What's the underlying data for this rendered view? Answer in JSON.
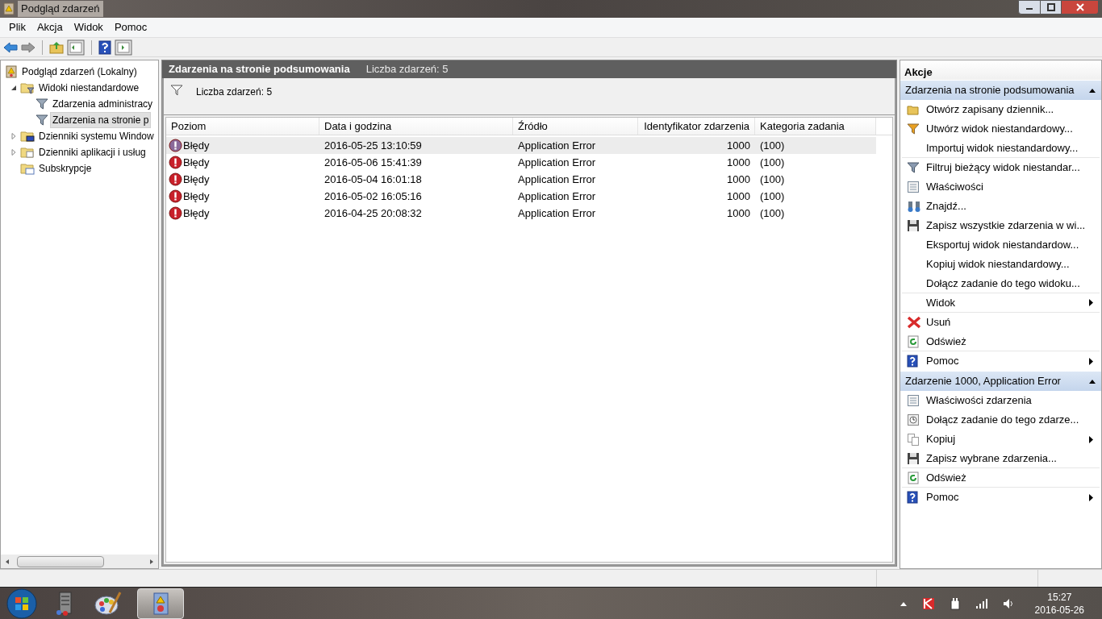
{
  "window": {
    "title": "Podgląd zdarzeń"
  },
  "menu": [
    "Plik",
    "Akcja",
    "Widok",
    "Pomoc"
  ],
  "tree": [
    {
      "label": "Podgląd zdarzeń (Lokalny)",
      "kind": "log",
      "selected": false,
      "children": [
        {
          "label": "Widoki niestandardowe",
          "kind": "folder-filter",
          "expanded": true,
          "selected": false,
          "children": [
            {
              "label": "Zdarzenia administracy",
              "kind": "filter",
              "selected": false
            },
            {
              "label": "Zdarzenia na stronie p",
              "kind": "filter",
              "selected": true
            }
          ]
        },
        {
          "label": "Dzienniki systemu Window",
          "kind": "folder-pc",
          "expanded": false,
          "selected": false
        },
        {
          "label": "Dzienniki aplikacji i usług",
          "kind": "folder",
          "expanded": false,
          "selected": false
        },
        {
          "label": "Subskrypcje",
          "kind": "folder-sub",
          "selected": false
        }
      ]
    }
  ],
  "center": {
    "title": "Zdarzenia na stronie podsumowania",
    "count": "Liczba zdarzeń: 5",
    "filter_text": "Liczba zdarzeń: 5"
  },
  "table": {
    "columns": [
      "Poziom",
      "Data i godzina",
      "Źródło",
      "Identyfikator zdarzenia",
      "Kategoria zadania"
    ],
    "rows": [
      {
        "level": "Błędy",
        "date": "2016-05-25 13:10:59",
        "source": "Application Error",
        "id": "1000",
        "category": "(100)",
        "selected": true
      },
      {
        "level": "Błędy",
        "date": "2016-05-06 15:41:39",
        "source": "Application Error",
        "id": "1000",
        "category": "(100)",
        "selected": false
      },
      {
        "level": "Błędy",
        "date": "2016-05-04 16:01:18",
        "source": "Application Error",
        "id": "1000",
        "category": "(100)",
        "selected": false
      },
      {
        "level": "Błędy",
        "date": "2016-05-02 16:05:16",
        "source": "Application Error",
        "id": "1000",
        "category": "(100)",
        "selected": false
      },
      {
        "level": "Błędy",
        "date": "2016-04-25 20:08:32",
        "source": "Application Error",
        "id": "1000",
        "category": "(100)",
        "selected": false
      }
    ]
  },
  "actions": {
    "title": "Akcje",
    "sections": [
      {
        "title": "Zdarzenia na stronie podsumowania",
        "expanded": true,
        "items": [
          {
            "label": "Otwórz zapisany dziennik...",
            "kind": "open",
            "submenu": false,
            "divider_below": false
          },
          {
            "label": "Utwórz widok niestandardowy...",
            "kind": "filter-new",
            "submenu": false,
            "divider_below": false
          },
          {
            "label": "Importuj widok niestandardowy...",
            "kind": "none",
            "submenu": false,
            "divider_below": true
          },
          {
            "label": "Filtruj bieżący widok niestandar...",
            "kind": "filter",
            "submenu": false,
            "divider_below": false
          },
          {
            "label": "Właściwości",
            "kind": "props",
            "submenu": false,
            "divider_below": false
          },
          {
            "label": "Znajdź...",
            "kind": "find",
            "submenu": false,
            "divider_below": false
          },
          {
            "label": "Zapisz wszystkie zdarzenia w wi...",
            "kind": "save",
            "submenu": false,
            "divider_below": false
          },
          {
            "label": "Eksportuj widok niestandardow...",
            "kind": "none",
            "submenu": false,
            "divider_below": false
          },
          {
            "label": "Kopiuj widok niestandardowy...",
            "kind": "none",
            "submenu": false,
            "divider_below": false
          },
          {
            "label": "Dołącz zadanie do tego widoku...",
            "kind": "none",
            "submenu": false,
            "divider_below": true
          },
          {
            "label": "Widok",
            "kind": "none",
            "submenu": true,
            "divider_below": true
          },
          {
            "label": "Usuń",
            "kind": "delete",
            "submenu": false,
            "divider_below": false
          },
          {
            "label": "Odśwież",
            "kind": "refresh",
            "submenu": false,
            "divider_below": true
          },
          {
            "label": "Pomoc",
            "kind": "help",
            "submenu": true,
            "divider_below": false
          }
        ]
      },
      {
        "title": "Zdarzenie 1000, Application Error",
        "expanded": true,
        "items": [
          {
            "label": "Właściwości zdarzenia",
            "kind": "props",
            "submenu": false,
            "divider_below": false
          },
          {
            "label": "Dołącz zadanie do tego zdarze...",
            "kind": "task",
            "submenu": false,
            "divider_below": false
          },
          {
            "label": "Kopiuj",
            "kind": "copy",
            "submenu": true,
            "divider_below": false
          },
          {
            "label": "Zapisz wybrane zdarzenia...",
            "kind": "save",
            "submenu": false,
            "divider_below": true
          },
          {
            "label": "Odśwież",
            "kind": "refresh",
            "submenu": false,
            "divider_below": true
          },
          {
            "label": "Pomoc",
            "kind": "help",
            "submenu": true,
            "divider_below": false
          }
        ]
      }
    ]
  },
  "clock": {
    "time": "15:27",
    "date": "2016-05-26"
  }
}
